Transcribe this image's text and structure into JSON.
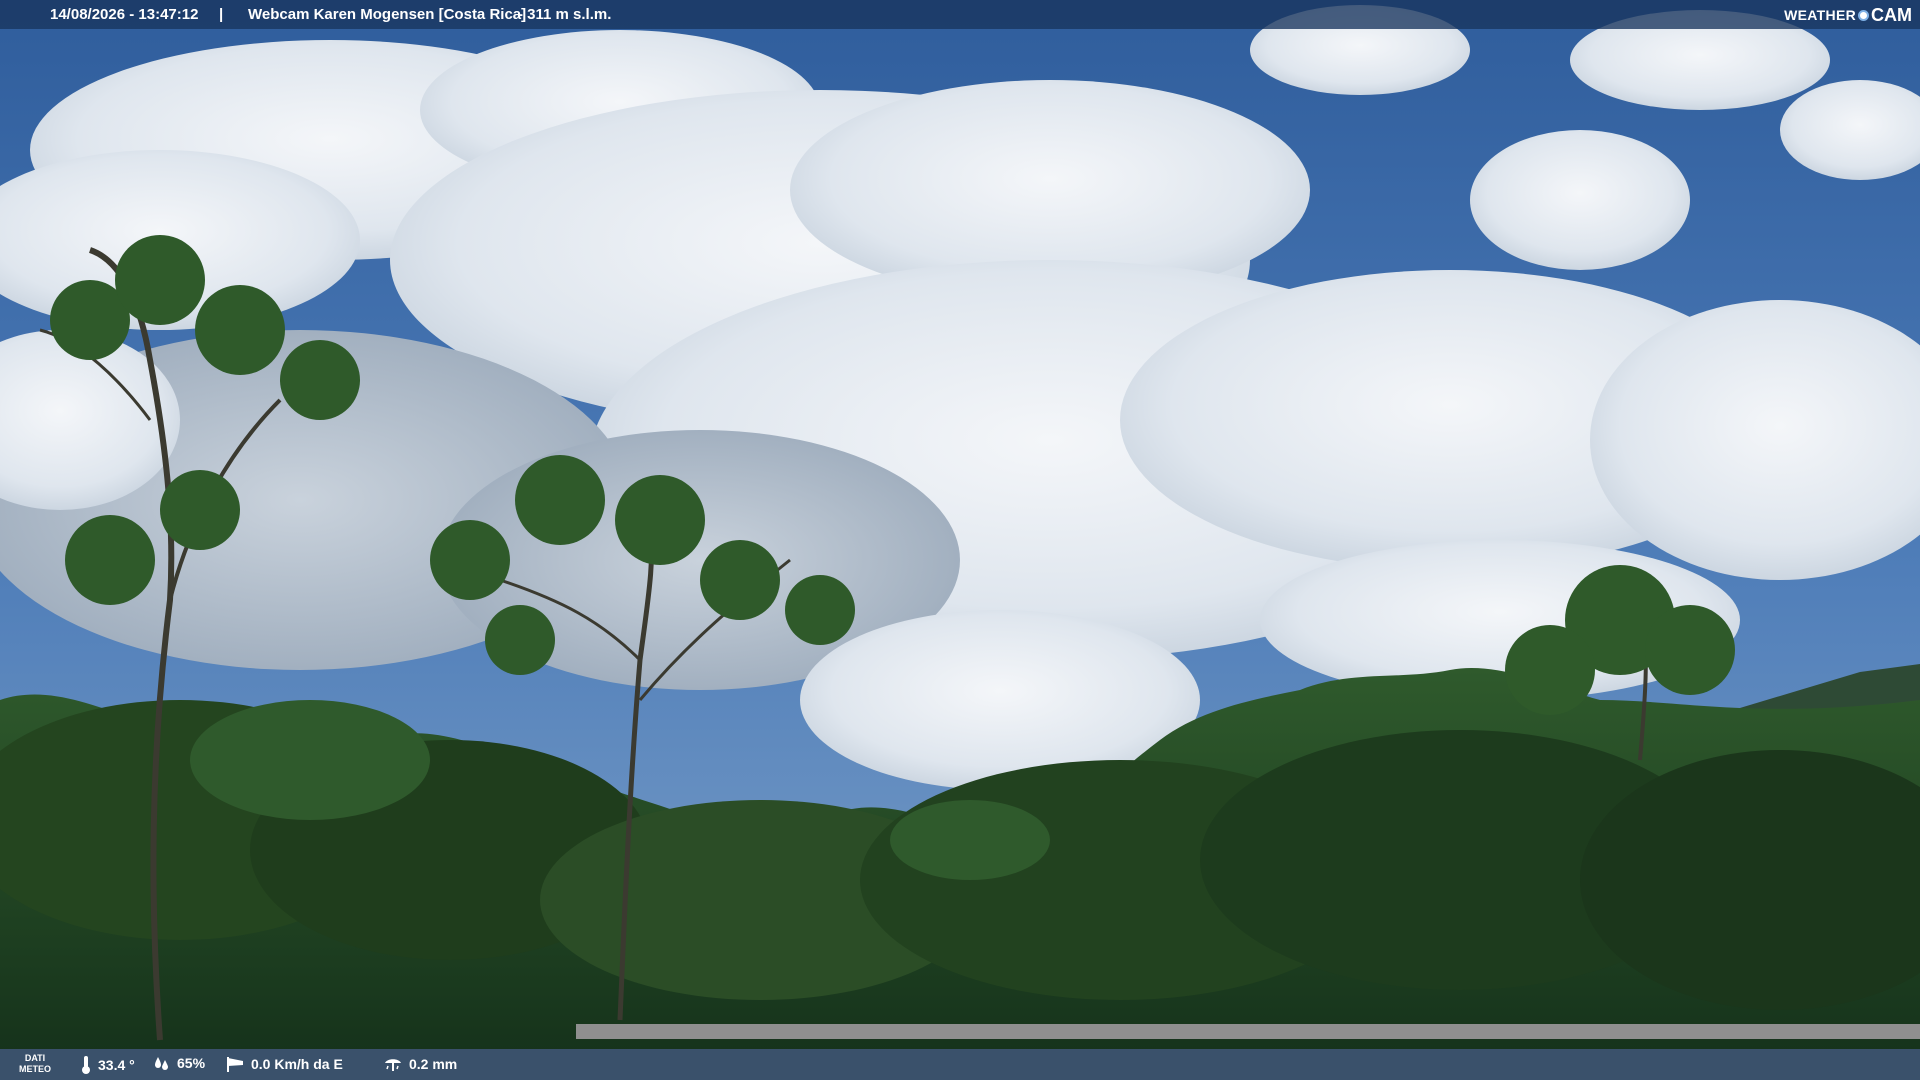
{
  "header": {
    "datetime": "14/08/2026 - 13:47:12",
    "separator": "|",
    "location": "Webcam Karen Mogensen [Costa Rica]",
    "altitude": "- 311 m s.l.m.",
    "logo_weather": "WEATHER",
    "logo_cam": "CAM"
  },
  "footer": {
    "dati_label_1": "DATI",
    "dati_label_2": "METEO",
    "temperature": "33.4 °",
    "humidity": "65%",
    "wind": "0.0 Km/h da E",
    "rain": "0.2 mm"
  },
  "icons": {
    "temperature": "thermometer-icon",
    "humidity": "humidity-icon",
    "wind": "windsock-icon",
    "rain": "rain-gauge-icon"
  },
  "colors": {
    "sky": "#3b6aa8",
    "cloud": "#e9eef4",
    "forest": "#1f3f22",
    "bar": "#18345e"
  }
}
